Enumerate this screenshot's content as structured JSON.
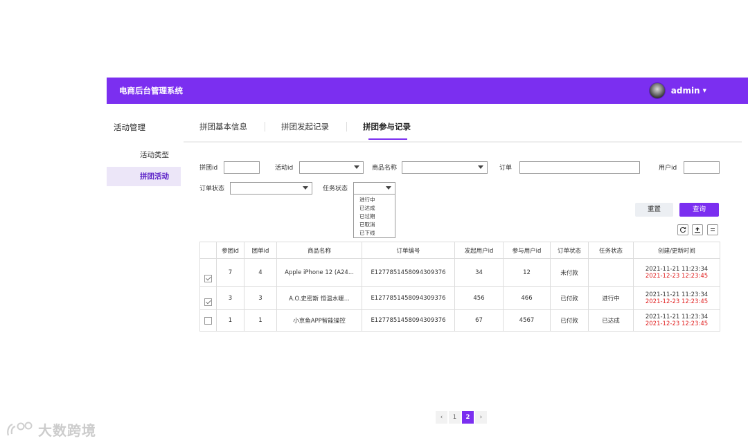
{
  "header": {
    "app_title": "电商后台管理系统",
    "username": "admin"
  },
  "sidebar": {
    "section_title": "活动管理",
    "items": [
      {
        "label": "活动类型"
      },
      {
        "label": "拼团活动"
      }
    ]
  },
  "tabs": [
    {
      "label": "拼团基本信息"
    },
    {
      "label": "拼团发起记录"
    },
    {
      "label": "拼团参与记录"
    }
  ],
  "filters": {
    "group_id_label": "拼团id",
    "group_id_value": "",
    "activity_id_label": "活动id",
    "activity_id_value": "",
    "product_name_label": "商品名称",
    "product_name_value": "",
    "order_label": "订单",
    "order_value": "",
    "user_id_label": "用户id",
    "user_id_value": "",
    "order_status_label": "订单状态",
    "order_status_value": "",
    "task_status_label": "任务状态",
    "task_status_value": "",
    "task_status_options": [
      "进行中",
      "已达成",
      "已过期",
      "已取消",
      "已下线"
    ]
  },
  "buttons": {
    "reset": "重置",
    "query": "查询"
  },
  "toolbar_icons": [
    "refresh-icon",
    "export-icon",
    "menu-icon"
  ],
  "table": {
    "headers": [
      "参团id",
      "团单id",
      "商品名称",
      "订单编号",
      "发起用户id",
      "参与用户id",
      "订单状态",
      "任务状态",
      "创建/更新时间"
    ],
    "rows": [
      {
        "checked": true,
        "join_id": "7",
        "group_id": "4",
        "product": "Apple iPhone 12 (A24...",
        "order_no": "E1277851458094309376",
        "initiator_id": "34",
        "participant_id": "12",
        "order_status": "未付款",
        "task_status": "",
        "created": "2021-11-21 11:23:34",
        "updated": "2021-12-23 12:23:45"
      },
      {
        "checked": true,
        "join_id": "3",
        "group_id": "3",
        "product": "A.O.史密斯 恒温水暖...",
        "order_no": "E1277851458094309376",
        "initiator_id": "456",
        "participant_id": "466",
        "order_status": "已付款",
        "task_status": "进行中",
        "created": "2021-11-21 11:23:34",
        "updated": "2021-12-23 12:23:45"
      },
      {
        "checked": false,
        "join_id": "1",
        "group_id": "1",
        "product": "小京鱼APP智能操控",
        "order_no": "E1277851458094309376",
        "initiator_id": "67",
        "participant_id": "4567",
        "order_status": "已付款",
        "task_status": "已达成",
        "created": "2021-11-21 11:23:34",
        "updated": "2021-12-23 12:23:45"
      }
    ]
  },
  "pagination": {
    "prev": "‹",
    "pages": [
      "1",
      "2"
    ],
    "current": "2",
    "next": "›"
  },
  "watermark": {
    "text": "大数跨境"
  },
  "colors": {
    "primary": "#7b2ff0",
    "active_bg": "#ece6f8",
    "danger": "#e01c1c"
  }
}
